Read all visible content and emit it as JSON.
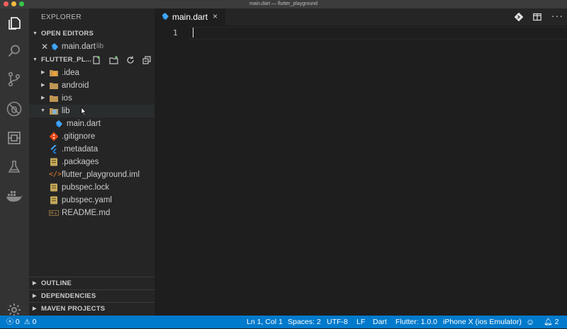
{
  "window": {
    "title": "main.dart — flutter_playground"
  },
  "sidebar": {
    "title": "EXPLORER",
    "open_editors": {
      "header": "OPEN EDITORS",
      "items": [
        {
          "name": "main.dart",
          "path": "lib"
        }
      ]
    },
    "project": {
      "header": "FLUTTER_PL...",
      "files": [
        {
          "name": ".idea",
          "type": "folder"
        },
        {
          "name": "android",
          "type": "folder"
        },
        {
          "name": "ios",
          "type": "folder"
        },
        {
          "name": "lib",
          "type": "folder-open"
        },
        {
          "name": "main.dart",
          "type": "dart"
        },
        {
          "name": ".gitignore",
          "type": "git"
        },
        {
          "name": ".metadata",
          "type": "flutter"
        },
        {
          "name": ".packages",
          "type": "yaml"
        },
        {
          "name": "flutter_playground.iml",
          "type": "xml"
        },
        {
          "name": "pubspec.lock",
          "type": "yaml"
        },
        {
          "name": "pubspec.yaml",
          "type": "yaml"
        },
        {
          "name": "README.md",
          "type": "md"
        }
      ]
    },
    "collapsed_sections": [
      "OUTLINE",
      "DEPENDENCIES",
      "MAVEN PROJECTS"
    ]
  },
  "editor": {
    "tab_label": "main.dart",
    "tab_close": "×",
    "line_number": "1"
  },
  "statusbar": {
    "errors": "0",
    "warnings": "0",
    "position": "Ln 1, Col 1",
    "spaces": "Spaces: 2",
    "encoding": "UTF-8",
    "eol": "LF",
    "language": "Dart",
    "flutter": "Flutter: 1.0.0",
    "device": "iPhone X (ios Emulator)",
    "notifications": "2"
  },
  "colors": {
    "accent": "#007acc",
    "dart_blue": "#42a5f5",
    "folder": "#c09553"
  }
}
